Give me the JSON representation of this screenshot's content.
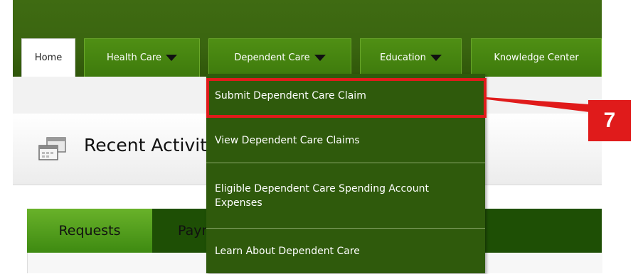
{
  "top_nav": {
    "tabs": [
      {
        "label": "Home",
        "has_dropdown": false,
        "active": true
      },
      {
        "label": "Health Care",
        "has_dropdown": true,
        "active": false
      },
      {
        "label": "Dependent Care",
        "has_dropdown": true,
        "active": false
      },
      {
        "label": "Education",
        "has_dropdown": true,
        "active": false
      },
      {
        "label": "Knowledge Center",
        "has_dropdown": false,
        "active": false
      }
    ]
  },
  "dropdown": {
    "items": [
      {
        "label": "Submit Dependent Care Claim",
        "highlighted": true
      },
      {
        "label": "View Dependent Care Claims",
        "highlighted": false
      },
      {
        "label": "Eligible Dependent Care Spending Account Expenses",
        "highlighted": false
      },
      {
        "label": "Learn About Dependent Care",
        "highlighted": false
      }
    ]
  },
  "panel": {
    "title": "Recent Activity",
    "icon": "windows-icon"
  },
  "sub_tabs": [
    {
      "label": "Requests",
      "active": true
    },
    {
      "label": "Payments",
      "active": false
    }
  ],
  "callout": {
    "number": "7"
  },
  "colors": {
    "nav_green": "#4f8f14",
    "banner_green": "#3a6510",
    "dropdown_green": "#2f5a0c",
    "callout_red": "#e01b1b"
  }
}
